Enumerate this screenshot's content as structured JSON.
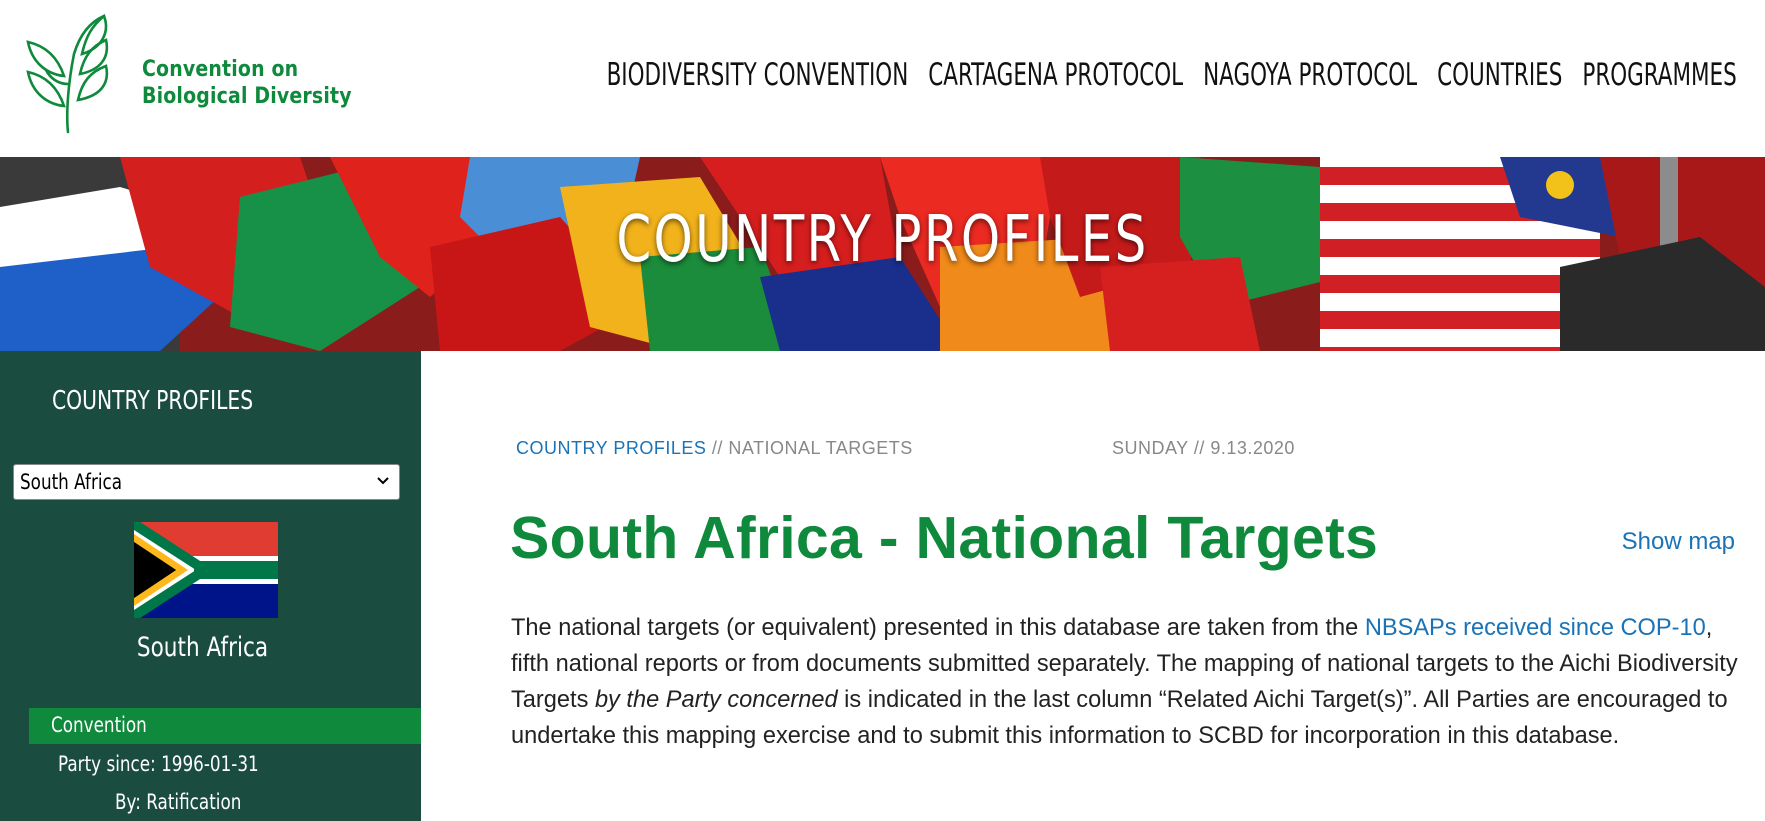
{
  "brand": {
    "line1": "Convention on",
    "line2": "Biological Diversity",
    "color": "#0f8a3c"
  },
  "nav": {
    "items": [
      "BIODIVERSITY CONVENTION",
      "CARTAGENA PROTOCOL",
      "NAGOYA PROTOCOL",
      "COUNTRIES",
      "PROGRAMMES"
    ]
  },
  "banner": {
    "title": "COUNTRY PROFILES"
  },
  "sidebar": {
    "title": "COUNTRY PROFILES",
    "selected_country": "South Africa",
    "flag_caption": "South Africa",
    "section_label": "Convention",
    "party_since": "Party since: 1996-01-31",
    "party_by": "By: Ratification",
    "bg_color": "#1a4d40",
    "accent_color": "#0f8a3c"
  },
  "main": {
    "breadcrumb_link": "COUNTRY PROFILES",
    "breadcrumb_sep": " // ",
    "breadcrumb_current": "NATIONAL TARGETS",
    "date": "SUNDAY // 9.13.2020",
    "title": "South Africa - National Targets",
    "show_map": "Show map",
    "intro_1": "The national targets (or equivalent) presented in this database are taken from the ",
    "intro_link": "NBSAPs received since COP-10",
    "intro_2": ", fifth national reports or from documents submitted separately. The mapping of national targets to the Aichi Biodiversity Targets ",
    "intro_em": "by the Party concerned",
    "intro_3": " is indicated in the last column “Related Aichi Target(s)”. All Parties are encouraged to undertake this mapping exercise and to submit this information to SCBD for incorporation in this database.",
    "link_color": "#1a73b6"
  }
}
